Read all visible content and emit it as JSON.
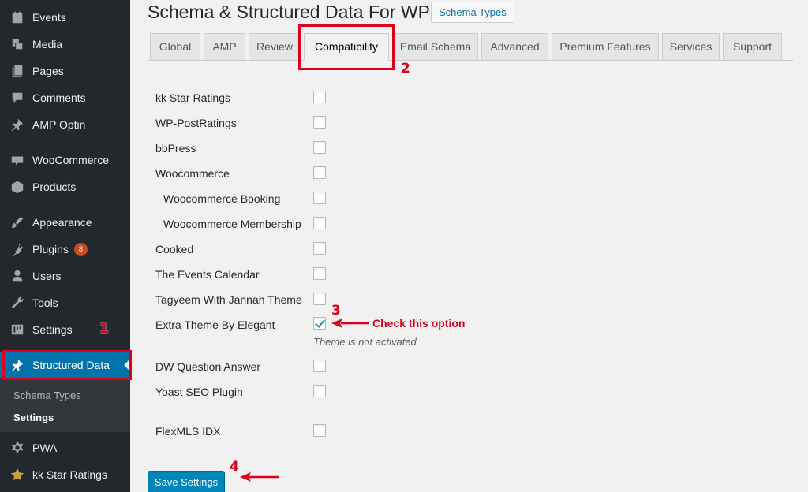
{
  "sidebar": {
    "items": [
      {
        "label": "Events",
        "icon": "calendar-icon"
      },
      {
        "label": "Media",
        "icon": "media-icon"
      },
      {
        "label": "Pages",
        "icon": "pages-icon"
      },
      {
        "label": "Comments",
        "icon": "comment-icon"
      },
      {
        "label": "AMP Optin",
        "icon": "pin-icon"
      },
      {
        "label": "WooCommerce",
        "icon": "woocommerce-icon"
      },
      {
        "label": "Products",
        "icon": "box-icon"
      },
      {
        "label": "Appearance",
        "icon": "brush-icon"
      },
      {
        "label": "Plugins",
        "icon": "plugin-icon",
        "badge": "8"
      },
      {
        "label": "Users",
        "icon": "user-icon"
      },
      {
        "label": "Tools",
        "icon": "wrench-icon"
      },
      {
        "label": "Settings",
        "icon": "settings-icon"
      },
      {
        "label": "Structured Data",
        "icon": "pin-icon"
      },
      {
        "label": "PWA",
        "icon": "gear-icon"
      },
      {
        "label": "kk Star Ratings",
        "icon": "star-icon"
      }
    ],
    "submenu": [
      "Schema Types",
      "Settings"
    ]
  },
  "header": {
    "title": "Schema & Structured Data For WP",
    "schema_types_button": "Schema Types"
  },
  "tabs": [
    "Global",
    "AMP",
    "Review",
    "Compatibility",
    "Email Schema",
    "Advanced",
    "Premium Features",
    "Services",
    "Support"
  ],
  "active_tab": "Compatibility",
  "options": [
    {
      "label": "kk Star Ratings",
      "checked": false
    },
    {
      "label": "WP-PostRatings",
      "checked": false
    },
    {
      "label": "bbPress",
      "checked": false
    },
    {
      "label": "Woocommerce",
      "checked": false
    },
    {
      "label": "Woocommerce Booking",
      "checked": false
    },
    {
      "label": "Woocommerce Membership",
      "checked": false
    },
    {
      "label": "Cooked",
      "checked": false
    },
    {
      "label": "The Events Calendar",
      "checked": false
    },
    {
      "label": "Tagyeem With Jannah Theme",
      "checked": false
    },
    {
      "label": "Extra Theme By Elegant",
      "checked": true
    },
    {
      "label": "DW Question Answer",
      "checked": false
    },
    {
      "label": "Yoast SEO Plugin",
      "checked": false
    },
    {
      "label": "FlexMLS IDX",
      "checked": false
    }
  ],
  "theme_note": "Theme is not activated",
  "save_button": "Save Settings",
  "annotations": {
    "step1": "1",
    "step2": "2",
    "step3": "3",
    "step4": "4",
    "callout": "Check this option",
    "color": "#e0001b"
  },
  "colors": {
    "sidebar_bg": "#23282d",
    "accent": "#0073aa",
    "button": "#0085ba"
  }
}
